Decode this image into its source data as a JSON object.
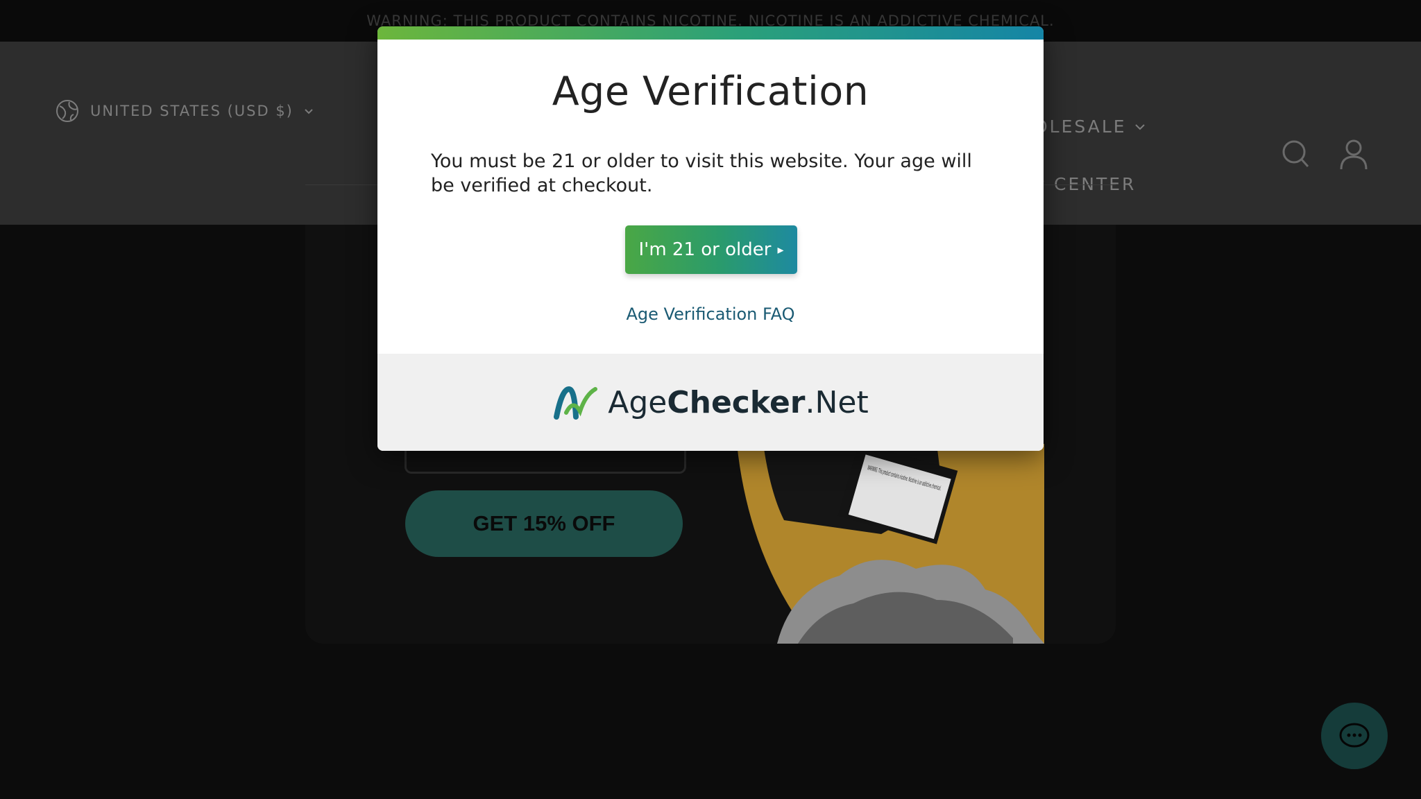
{
  "warning_bar": {
    "text": "WARNING: THIS PRODUCT CONTAINS NICOTINE. NICOTINE IS AN ADDICTIVE CHEMICAL."
  },
  "header": {
    "region_selector": "UNITED STATES (USD $)",
    "nav_wholesale": "OLESALE",
    "nav_help": "P CENTER",
    "icons": [
      "globe-icon",
      "chevron-down-icon",
      "search-icon",
      "account-icon"
    ]
  },
  "promo": {
    "button_label": "GET 15% OFF",
    "product_box_text": "WARNING: This product contains nicotine. Nicotine is an addictive chemical."
  },
  "modal": {
    "title": "Age Verification",
    "message": "You must be 21 or older to visit this website. Your age will be verified at checkout.",
    "confirm_label": "I'm 21 or older",
    "faq_link": "Age Verification FAQ",
    "brand": {
      "part1": "Age",
      "part2": "Checker",
      "part3": ".Net"
    }
  },
  "colors": {
    "accent_green": "#4aa745",
    "accent_teal": "#1e8aa0",
    "link": "#1a5a73",
    "promo_button": "#1e4d47"
  }
}
